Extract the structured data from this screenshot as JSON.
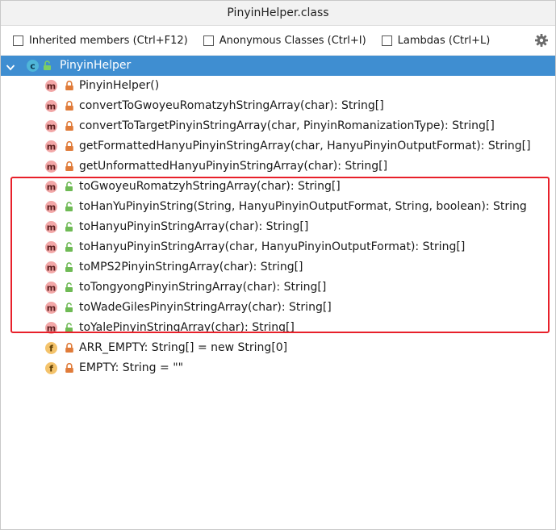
{
  "window": {
    "title": "PinyinHelper.class"
  },
  "toolbar": {
    "options": [
      {
        "label": "Inherited members (Ctrl+F12)",
        "checked": false
      },
      {
        "label": "Anonymous Classes (Ctrl+I)",
        "checked": false
      },
      {
        "label": "Lambdas (Ctrl+L)",
        "checked": false
      }
    ],
    "settings_icon": "gear-icon"
  },
  "colors": {
    "selection": "#3f8ed1",
    "method_icon": "#f2a7a7",
    "field_icon": "#f4c36b",
    "lock_private": "#e07b39",
    "lock_public": "#6fba55",
    "highlight_border": "#e8202a"
  },
  "tree": {
    "root": {
      "label": "PinyinHelper",
      "icon": "class-icon",
      "selected": true,
      "expanded": true
    },
    "members": [
      {
        "kind": "method",
        "access": "private",
        "label": "PinyinHelper()"
      },
      {
        "kind": "method",
        "access": "private",
        "label": "convertToGwoyeuRomatzyhStringArray(char): String[]"
      },
      {
        "kind": "method",
        "access": "private",
        "label": "convertToTargetPinyinStringArray(char, PinyinRomanizationType): String[]"
      },
      {
        "kind": "method",
        "access": "private",
        "label": "getFormattedHanyuPinyinStringArray(char, HanyuPinyinOutputFormat): String[]"
      },
      {
        "kind": "method",
        "access": "private",
        "label": "getUnformattedHanyuPinyinStringArray(char): String[]"
      },
      {
        "kind": "method",
        "access": "public",
        "label": "toGwoyeuRomatzyhStringArray(char): String[]"
      },
      {
        "kind": "method",
        "access": "public",
        "label": "toHanYuPinyinString(String, HanyuPinyinOutputFormat, String, boolean): String"
      },
      {
        "kind": "method",
        "access": "public",
        "label": "toHanyuPinyinStringArray(char): String[]"
      },
      {
        "kind": "method",
        "access": "public",
        "label": "toHanyuPinyinStringArray(char, HanyuPinyinOutputFormat): String[]"
      },
      {
        "kind": "method",
        "access": "public",
        "label": "toMPS2PinyinStringArray(char): String[]"
      },
      {
        "kind": "method",
        "access": "public",
        "label": "toTongyongPinyinStringArray(char): String[]"
      },
      {
        "kind": "method",
        "access": "public",
        "label": "toWadeGilesPinyinStringArray(char): String[]"
      },
      {
        "kind": "method",
        "access": "public",
        "label": "toYalePinyinStringArray(char): String[]"
      },
      {
        "kind": "field",
        "access": "private",
        "label": "ARR_EMPTY: String[] = new String[0]"
      },
      {
        "kind": "field",
        "access": "private",
        "label": "EMPTY: String = \"\""
      }
    ]
  }
}
